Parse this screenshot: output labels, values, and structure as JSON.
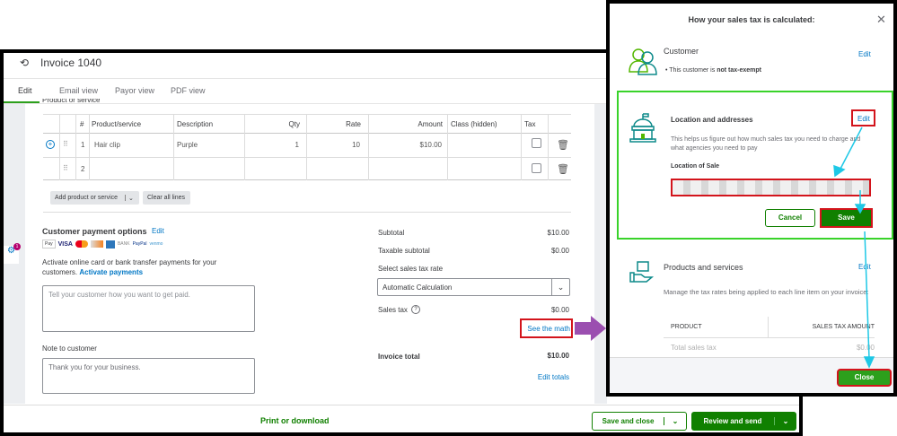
{
  "invoice": {
    "title": "Invoice 1040",
    "tabs": [
      "Edit",
      "Email view",
      "Payor view",
      "PDF view"
    ],
    "section_label": "Product or service",
    "table": {
      "headers": [
        "#",
        "Product/service",
        "Description",
        "Qty",
        "Rate",
        "Amount",
        "Class (hidden)",
        "Tax"
      ],
      "rows": [
        {
          "num": "1",
          "product": "Hair clip",
          "description": "Purple",
          "qty": "1",
          "rate": "10",
          "amount": "$10.00"
        },
        {
          "num": "2",
          "product": "",
          "description": "",
          "qty": "",
          "rate": "",
          "amount": ""
        }
      ]
    },
    "add_product_label": "Add product or service",
    "clear_lines_label": "Clear all lines",
    "payment": {
      "title": "Customer payment options",
      "edit": "Edit",
      "methods": [
        "Pay",
        "VISA",
        "BANK",
        "PayPal",
        "venmo"
      ],
      "text": "Activate online card or bank transfer payments for your customers.",
      "activate": "Activate payments",
      "placeholder": "Tell your customer how you want to get paid."
    },
    "note": {
      "label": "Note to customer",
      "value": "Thank you for your business."
    },
    "totals": {
      "subtotal_label": "Subtotal",
      "subtotal": "$10.00",
      "taxable_label": "Taxable subtotal",
      "taxable": "$0.00",
      "rate_label": "Select sales tax rate",
      "rate_value": "Automatic Calculation",
      "sales_tax_label": "Sales tax",
      "sales_tax": "$0.00",
      "see_math": "See the math",
      "total_label": "Invoice total",
      "total": "$10.00",
      "edit_totals": "Edit totals"
    },
    "notification_count": "1",
    "footer": {
      "print": "Print or download",
      "save_close": "Save and close",
      "review_send": "Review and send"
    }
  },
  "modal": {
    "title": "How your sales tax is calculated:",
    "customer": {
      "title": "Customer",
      "edit": "Edit",
      "bullet_prefix": "This customer is ",
      "bullet_bold": "not tax-exempt"
    },
    "location": {
      "title": "Location and addresses",
      "edit": "Edit",
      "desc": "This helps us figure out how much sales tax you need to charge and what agencies you need to pay",
      "field_label": "Location of Sale",
      "cancel": "Cancel",
      "save": "Save"
    },
    "products": {
      "title": "Products and services",
      "edit": "Edit",
      "desc": "Manage the tax rates being applied to each line item on your invoice:",
      "col_product": "PRODUCT",
      "col_amount": "SALES TAX AMOUNT",
      "total_label": "Total sales tax",
      "total": "$0.00"
    },
    "close": "Close"
  },
  "colors": {
    "green": "#2ca01c",
    "dark_green": "#108000",
    "link": "#0077c5",
    "annotation_red": "#d3141c",
    "annotation_cyan": "#1ec8e6",
    "annotation_purple": "#9b4fb0",
    "highlight_green": "#39d32a"
  }
}
